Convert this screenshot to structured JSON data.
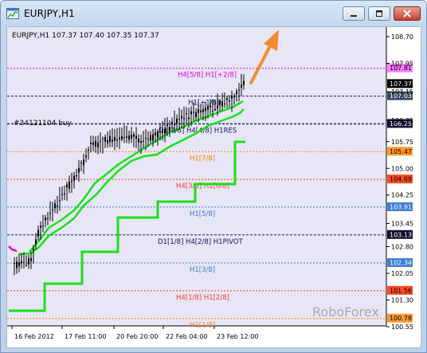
{
  "window": {
    "title": "EURJPY,H1"
  },
  "chart": {
    "header": "EURJPY,H1  107.37 107.40 107.35 107.37",
    "watermark": "RoboForex",
    "order_label": "#34121104 buy",
    "colors": {
      "background": "#e6e6f6",
      "candle": "#000000",
      "green_line": "#19e019",
      "arrow": "#f58a2e",
      "magenta": "#e000e0",
      "orange": "#ff8000",
      "red": "#ff3b1f",
      "blue": "#3a78c9",
      "dark": "#151560"
    },
    "price_axis": {
      "ticks": [
        "108.70",
        "107.95",
        "107.15",
        "106.35",
        "105.75",
        "105.00",
        "104.25",
        "103.45",
        "102.80",
        "102.05",
        "101.30",
        "100.55"
      ]
    },
    "time_axis": {
      "ticks": [
        "16 Feb 2012",
        "17 Feb 11:00",
        "20 Feb 20:00",
        "22 Feb 04:00",
        "23 Feb 12:00"
      ]
    },
    "levels": [
      {
        "label": "H4[5/8] H1[+2/8]",
        "price_tag": "107.81",
        "color": "magenta",
        "tag_bg": "#ff7cff",
        "tag_fg": "#000000"
      },
      {
        "label": "",
        "price_tag": "107.37",
        "color": "none",
        "tag_bg": "#000000",
        "tag_fg": "#ffffff"
      },
      {
        "label": "H1[+1/8]",
        "price_tag": "107.03",
        "color": "dark",
        "tag_bg": "#374a61",
        "tag_fg": "#ffffff"
      },
      {
        "label": "D1[2/8] H4[4/8] H1RES",
        "price_tag": "106.25",
        "color": "dark",
        "tag_bg": "#111133",
        "tag_fg": "#ffffff"
      },
      {
        "label": "H1[7/8]",
        "price_tag": "105.47",
        "color": "orange",
        "tag_bg": "#ff9a2a",
        "tag_fg": "#000000"
      },
      {
        "label": "H4[3/8] H1[6/8]",
        "price_tag": "104.69",
        "color": "red",
        "tag_bg": "#ff4a26",
        "tag_fg": "#000000"
      },
      {
        "label": "H1[5/8]",
        "price_tag": "103.91",
        "color": "blue",
        "tag_bg": "#3f7fd4",
        "tag_fg": "#ffffff"
      },
      {
        "label": "D1[1/8] H4[2/8] H1PIVOT",
        "price_tag": "103.13",
        "color": "dark",
        "tag_bg": "#101030",
        "tag_fg": "#ffffff"
      },
      {
        "label": "H1[3/8]",
        "price_tag": "102.34",
        "color": "blue",
        "tag_bg": "#3f7fd4",
        "tag_fg": "#ffffff"
      },
      {
        "label": "H4[1/8] H1[2/8]",
        "price_tag": "101.56",
        "color": "red",
        "tag_bg": "#ff4a26",
        "tag_fg": "#000000"
      },
      {
        "label": "H1[1/8]",
        "price_tag": "100.78",
        "color": "orange",
        "tag_bg": "#ff9a2a",
        "tag_fg": "#000000"
      }
    ]
  }
}
